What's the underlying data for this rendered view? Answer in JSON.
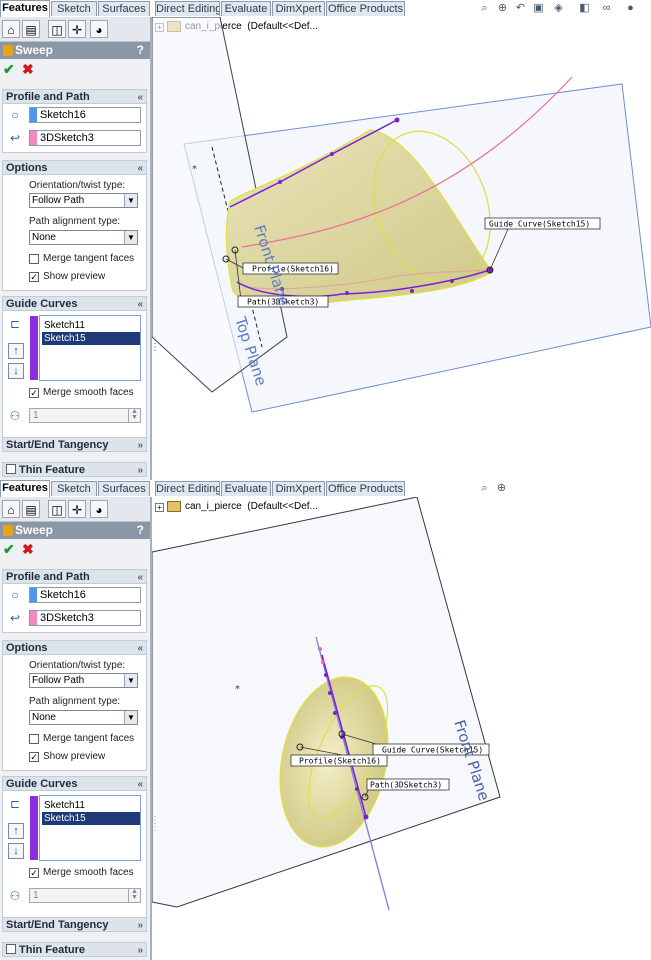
{
  "tabs": [
    "Features",
    "Sketch",
    "Surfaces",
    "Direct Editing",
    "Evaluate",
    "DimXpert",
    "Office Products"
  ],
  "panes": [
    {
      "view_icons": [
        "zoom-to-fit-icon",
        "zoom-area-icon",
        "previous-view-icon",
        "section-view-icon",
        "view-orientation-icon",
        "display-style-icon",
        "hide-show-icon",
        "appearance-icon"
      ]
    },
    {
      "view_icons": [
        "zoom-to-fit-icon",
        "zoom-area-icon"
      ]
    }
  ],
  "pm": {
    "title": "Sweep",
    "help": "?",
    "ok_glyph": "✔",
    "cancel_glyph": "✖",
    "profile_and_path": {
      "header": "Profile and Path",
      "profile": "Sketch16",
      "path": "3DSketch3",
      "profile_color": "#4f97e6",
      "path_color": "#f08ac0"
    },
    "options": {
      "header": "Options",
      "orientation_label": "Orientation/twist type:",
      "orientation_value": "Follow Path",
      "alignment_label": "Path alignment type:",
      "alignment_value": "None",
      "merge_tangent_label": "Merge tangent faces",
      "merge_tangent_checked": false,
      "show_preview_label": "Show preview",
      "show_preview_checked": true
    },
    "guide_curves": {
      "header": "Guide Curves",
      "items": [
        "Sketch11",
        "Sketch15"
      ],
      "selected": "Sketch15",
      "merge_smooth_label": "Merge smooth faces",
      "merge_smooth_checked": true,
      "spin_value": "1",
      "bar_color": "#8c2ee0"
    },
    "start_end": {
      "header": "Start/End Tangency"
    },
    "thin": {
      "header": "Thin Feature",
      "checked": false
    }
  },
  "tree": {
    "name": "can_i_pierce",
    "config": "(Default<<Def..."
  },
  "viewport1": {
    "front_plane": "Front Plane",
    "top_plane": "Top Plane",
    "callouts": {
      "guide": "Guide Curve(Sketch15)",
      "profile": "Profile(Sketch16)",
      "path": "Path(3DSketch3)"
    }
  },
  "viewport2": {
    "front_plane": "Front Plane",
    "callouts": {
      "guide": "Guide Curve(Sketch15)",
      "profile": "Profile(Sketch16)",
      "path": "Path(3DSketch3)"
    }
  },
  "colors": {
    "accent": "#8b97a6",
    "guide": "#7a1fd8",
    "path": "#e36fa4",
    "profile": "#d8d83a",
    "selection": "#1e3a78"
  }
}
